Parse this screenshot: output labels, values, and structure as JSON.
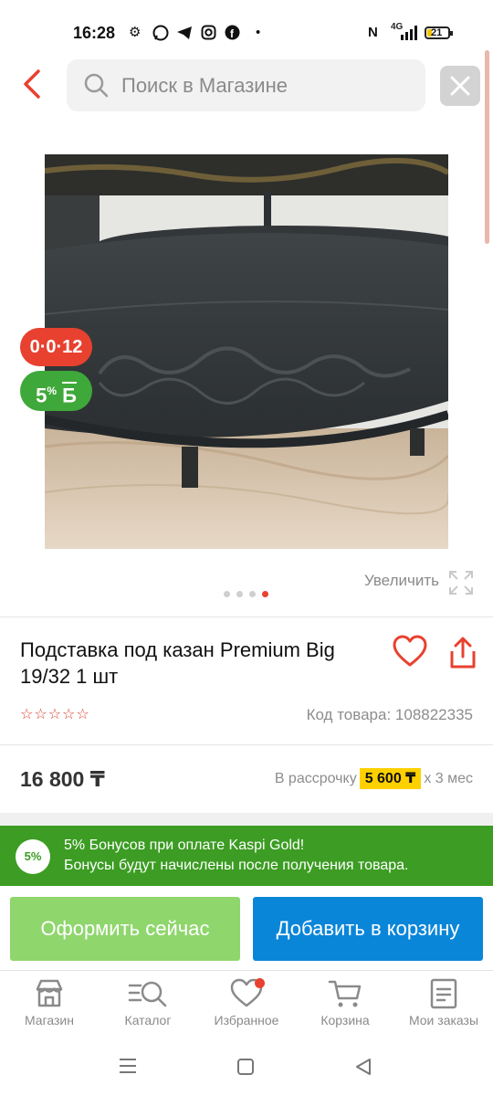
{
  "status_bar": {
    "time": "16:28",
    "battery": "21",
    "network": "4G"
  },
  "header": {
    "search_placeholder": "Поиск в Магазине",
    "back_icon": "chevron-left-icon",
    "close_icon": "close-icon"
  },
  "badges": {
    "installment": "0·0·12",
    "bonus_value": "5",
    "bonus_unit": "%",
    "bonus_currency": "Б"
  },
  "gallery": {
    "zoom_label": "Увеличить",
    "dots": 4,
    "active_dot": 4
  },
  "product": {
    "title": "Подставка под казан Premium Big 19/32 1 шт",
    "rating_stars": "☆☆☆☆☆",
    "code": "Код товара: 108822335",
    "price": "16 800 ₸",
    "installment_prefix": "В рассрочку",
    "installment_amount": "5 600 ₸",
    "installment_suffix": "x 3 мес"
  },
  "promo": {
    "badge": "5%",
    "line1": "5% Бонусов при оплате Kaspi Gold!",
    "line2": "Бонусы будут начислены после получения товара."
  },
  "actions": {
    "buy_now": "Оформить сейчас",
    "add_to_cart": "Добавить в корзину"
  },
  "bottom_nav": [
    {
      "label": "Магазин",
      "icon": "store-icon"
    },
    {
      "label": "Каталог",
      "icon": "catalog-search-icon"
    },
    {
      "label": "Избранное",
      "icon": "heart-icon"
    },
    {
      "label": "Корзина",
      "icon": "cart-icon"
    },
    {
      "label": "Мои заказы",
      "icon": "orders-icon"
    }
  ],
  "colors": {
    "accent_red": "#e8412f",
    "bonus_green": "#3fa83a",
    "promo_green": "#3c9c23",
    "cart_blue": "#0a86d9",
    "buy_green": "#8fd66d",
    "highlight_yellow": "#ffd000"
  }
}
